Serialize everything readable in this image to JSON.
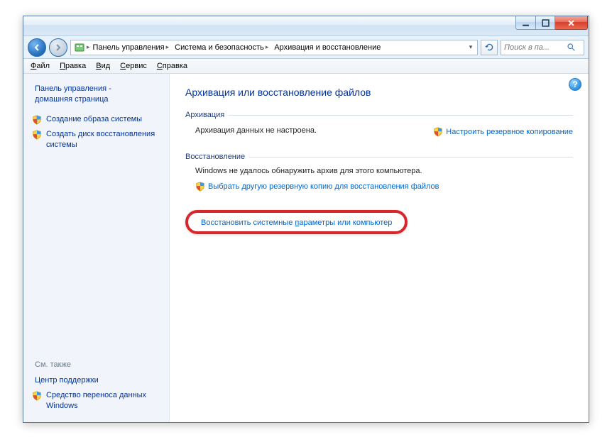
{
  "title_bar": {
    "minimize_tooltip": "Свернуть",
    "maximize_tooltip": "Развернуть",
    "close_tooltip": "Закрыть"
  },
  "breadcrumb": {
    "parts": [
      "Панель управления",
      "Система и безопасность",
      "Архивация и восстановление"
    ]
  },
  "search": {
    "placeholder": "Поиск в па..."
  },
  "menu": {
    "file": "айл",
    "file_key": "Ф",
    "edit": "равка",
    "edit_key": "П",
    "view": "ид",
    "view_key": "В",
    "service": "ервис",
    "service_key": "С",
    "help": "правка",
    "help_key": "С"
  },
  "sidebar": {
    "home1": "Панель управления -",
    "home2": "домашняя страница",
    "create_image": "Создание образа системы",
    "create_disc1": "Создать диск восстановления",
    "create_disc2": "системы",
    "see_also": "См. также",
    "support": "Центр поддержки",
    "transfer1": "Средство переноса данных",
    "transfer2": "Windows"
  },
  "main": {
    "heading": "Архивация или восстановление файлов",
    "backup_section": "Архивация",
    "backup_status": "Архивация данных не настроена.",
    "backup_setup": "Настроить резервное копирование",
    "restore_section": "Восстановление",
    "restore_status": "Windows не удалось обнаружить архив для этого компьютера.",
    "restore_other": "Выбрать другую резервную копию для восстановления файлов",
    "restore_sys_a": "Восстановить системные ",
    "restore_sys_key": "п",
    "restore_sys_b": "араметры или компьютер"
  }
}
